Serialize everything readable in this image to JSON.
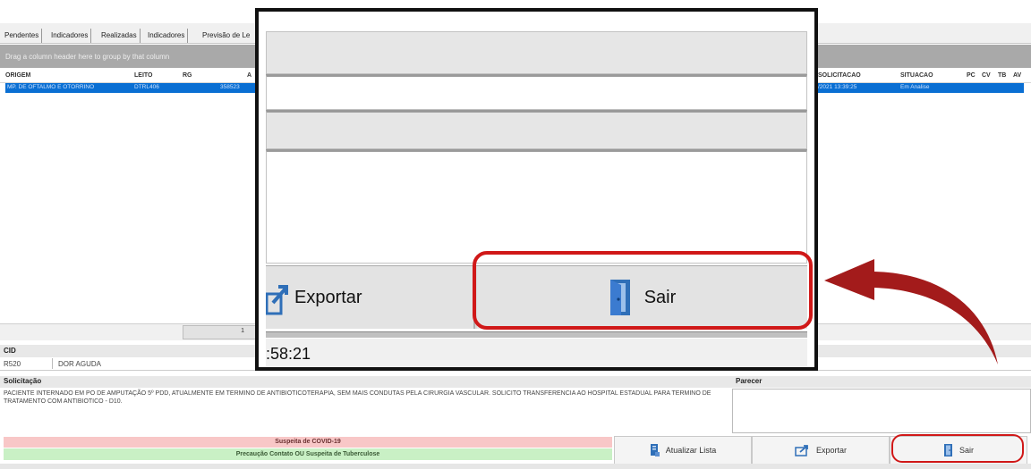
{
  "tabs": [
    "Pendentes",
    "Indicadores",
    "Realizadas",
    "Indicadores",
    "Previsão de Le"
  ],
  "group_panel_hint": "Drag a column header here to group by that column",
  "grid": {
    "columns_left": [
      "ORIGEM",
      "LEITO",
      "RG",
      "A"
    ],
    "columns_right": [
      "SOLICITACAO",
      "SITUACAO",
      "PC",
      "CV",
      "TB",
      "AV"
    ],
    "selected_row": {
      "origem": "MP. DE OFTALMO E OTORRINO",
      "leito": "DTRL406",
      "rg": "358523",
      "solicitacao": "/2021 13:39:25",
      "situacao": "Em Analise"
    }
  },
  "pager": {
    "page": "1"
  },
  "cid": {
    "header": "CID",
    "code": "R520",
    "description": "DOR AGUDA"
  },
  "solicitacao": {
    "header": "Solicitação",
    "text": "PACIENTE INTERNADO EM PO  DE AMPUTAÇÃO 5º PDD, ATUALMENTE EM TERMINO DE ANTIBIOTICOTERAPIA, SEM MAIS CONDUTAS PELA CIRURGIA VASCULAR. SOLICITO TRANSFERENCIA AO HOSPITAL ESTADUAL PARA TERMINO DE TRATAMENTO COM ANTIBIOTICO - D10."
  },
  "parecer": {
    "header": "Parecer"
  },
  "alerts": {
    "covid": "Suspeita de COVID-19",
    "tuberculose": "Precaução Contato OU Suspeita de Tuberculose"
  },
  "buttons": {
    "atualizar": "Atualizar Lista",
    "exportar": "Exportar",
    "sair": "Sair"
  },
  "zoom": {
    "exportar_label": "Exportar",
    "sair_label": "Sair",
    "timer": ":58:21"
  },
  "colors": {
    "highlight": "#d01818",
    "arrow": "#a31b1b",
    "selection": "#0a6fd3",
    "covid_bg": "#f8c7c7",
    "tuberculose_bg": "#c9f0c5"
  },
  "icons": [
    "export-icon",
    "door-exit-icon",
    "refresh-list-icon"
  ]
}
